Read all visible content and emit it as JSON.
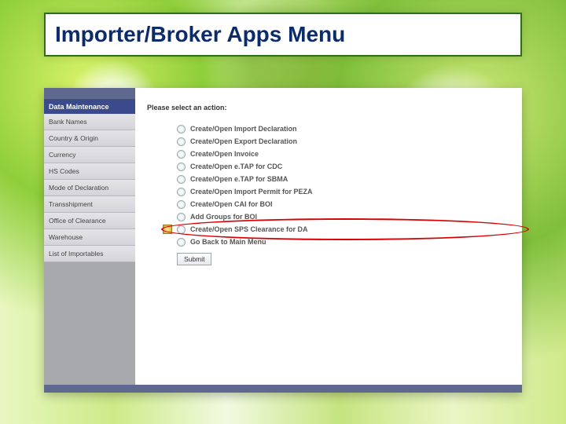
{
  "title": "Importer/Broker Apps Menu",
  "sidebar": {
    "header": "Data Maintenance",
    "items": [
      "Bank Names",
      "Country & Origin",
      "Currency",
      "HS Codes",
      "Mode of Declaration",
      "Transshipment",
      "Office of Clearance",
      "Warehouse",
      "List of Importables"
    ]
  },
  "content": {
    "prompt": "Please select an action:",
    "options": [
      "Create/Open Import Declaration",
      "Create/Open Export Declaration",
      "Create/Open Invoice",
      "Create/Open e.TAP for CDC",
      "Create/Open e.TAP for SBMA",
      "Create/Open Import Permit for PEZA",
      "Create/Open CAI for BOI",
      "Add Groups for BOI",
      "Create/Open SPS Clearance for DA",
      "Go Back to Main Menu"
    ],
    "highlighted_index": 8,
    "submit": "Submit"
  }
}
